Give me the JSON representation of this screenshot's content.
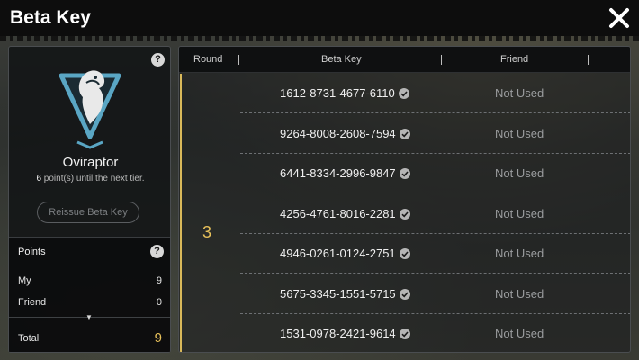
{
  "header": {
    "title": "Beta Key"
  },
  "left_panel": {
    "dinosaur_name": "Oviraptor",
    "points_needed": "6",
    "points_text": " point(s) until the next tier.",
    "reissue_label": "Reissue Beta Key",
    "points": {
      "heading": "Points",
      "rows": [
        {
          "label": "My",
          "value": "9"
        },
        {
          "label": "Friend",
          "value": "0"
        }
      ],
      "total_label": "Total",
      "total_value": "9"
    }
  },
  "table": {
    "columns": [
      "Round",
      "Beta Key",
      "Friend"
    ],
    "round": "3",
    "rows": [
      {
        "key": "1612-8731-4677-6110",
        "friend": "Not Used"
      },
      {
        "key": "9264-8008-2608-7594",
        "friend": "Not Used"
      },
      {
        "key": "6441-8334-2996-9847",
        "friend": "Not Used"
      },
      {
        "key": "4256-4761-8016-2281",
        "friend": "Not Used"
      },
      {
        "key": "4946-0261-0124-2751",
        "friend": "Not Used"
      },
      {
        "key": "5675-3345-1551-5715",
        "friend": "Not Used"
      },
      {
        "key": "1531-0978-2421-9614",
        "friend": "Not Used"
      }
    ]
  },
  "icons": {
    "close": "close-icon",
    "help": "help-icon",
    "tier": "tier-emblem-icon",
    "check": "check-circle-icon"
  },
  "colors": {
    "accent_gold": "#e8c15a",
    "tier_blue": "#5aa6c4"
  }
}
